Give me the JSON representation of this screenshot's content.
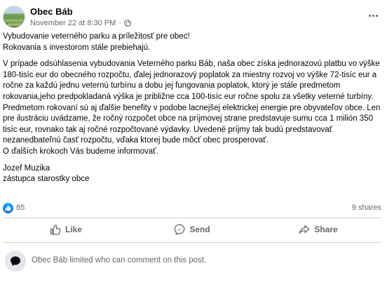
{
  "post": {
    "page_name": "Obec Báb",
    "timestamp": "November 22 at 8:30 PM",
    "separator": "·",
    "privacy_icon": "globe-icon",
    "more_icon": "more-options-icon",
    "text": {
      "line1": "Vybudovanie veterného parku a  príležitosť pre obec!",
      "line2": "Rokovania s investorom stále prebiehajú.",
      "paragraph": "V prípade odsúhlasenia vybudovania Veterného parku Báb, naša obec získa jednorazovú platbu vo výške 180-tisíc eur do obecného rozpočtu, ďalej jednorazový poplatok za miestny rozvoj vo výške 72-tisíc eur a ročne za každú jednu veternú turbínu a dobu jej fungovania poplatok, ktorý je stále predmetom rokovania,jeho predpokladaná výška je približne cca 100-tisíc eur ročne spolu za všetky veterné turbíny. Predmetom rokovaní sú aj ďalšie benefity v podobe lacnejšej elektrickej energie pre obyvateľov obce. Len pre ilustráciu uvádzame, že ročný rozpočet obce na príjmovej strane predstavuje sumu cca 1 milión 350 tisíc eur, rovnako tak aj ročné rozpočtované výdavky. Uvedené príjmy tak budú predstavovať nezanedbateľnú časť rozpočtu, vďaka ktorej bude môcť obec prosperovať.",
      "closing": "O ďalších krokoch Vás budeme informovať.",
      "signature_name": "Jozef Muzika",
      "signature_title": "zástupca starostky obce"
    }
  },
  "stats": {
    "reaction_icon": "like-reaction-icon",
    "reaction_count": "85",
    "shares": "9 shares"
  },
  "actions": {
    "like": "Like",
    "send": "Send",
    "share": "Share"
  },
  "comments": {
    "note": "Obec Báb limited who can comment on this post."
  },
  "colors": {
    "secondary_text": "#65676b",
    "like_blue": "#0866ff",
    "divider": "#ced0d4"
  }
}
